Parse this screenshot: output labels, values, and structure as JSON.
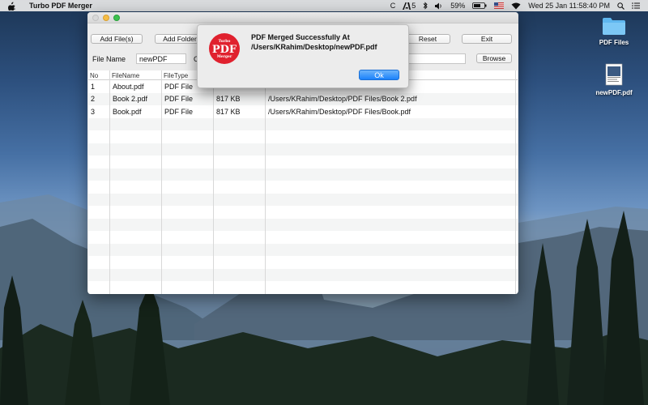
{
  "menubar": {
    "app_name": "Turbo PDF Merger",
    "status_c": "C",
    "adobe_count": "5",
    "battery": "59%",
    "clock": "Wed 25 Jan  11:58:40 PM"
  },
  "desktop": {
    "icons": [
      {
        "label": "PDF Files"
      },
      {
        "label": "newPDF.pdf"
      }
    ]
  },
  "window": {
    "toolbar": {
      "add_files": "Add File(s)",
      "add_folder": "Add Folder",
      "reset": "Reset",
      "exit": "Exit",
      "browse": "Browse"
    },
    "file_name_label": "File Name",
    "file_name_value": "newPDF",
    "output_label_partial": "O",
    "output_path_value": "",
    "table": {
      "columns": [
        "No",
        "FileName",
        "FileType",
        "",
        ""
      ],
      "rows": [
        {
          "no": "1",
          "name": "About.pdf",
          "type": "PDF File",
          "size": "",
          "path": ""
        },
        {
          "no": "2",
          "name": "Book 2.pdf",
          "type": "PDF File",
          "size": "817 KB",
          "path": "/Users/KRahim/Desktop/PDF Files/Book 2.pdf"
        },
        {
          "no": "3",
          "name": "Book.pdf",
          "type": "PDF File",
          "size": "817 KB",
          "path": "/Users/KRahim/Desktop/PDF Files/Book.pdf"
        }
      ]
    }
  },
  "dialog": {
    "message": "PDF Merged Successfully At /Users/KRahim/Desktop/newPDF.pdf",
    "ok_label": "Ok",
    "logo_top": "Turbo",
    "logo_main": "PDF",
    "logo_bottom": "Merger"
  },
  "colors": {
    "accent": "#1a82fb",
    "logo_red": "#e0212e"
  }
}
